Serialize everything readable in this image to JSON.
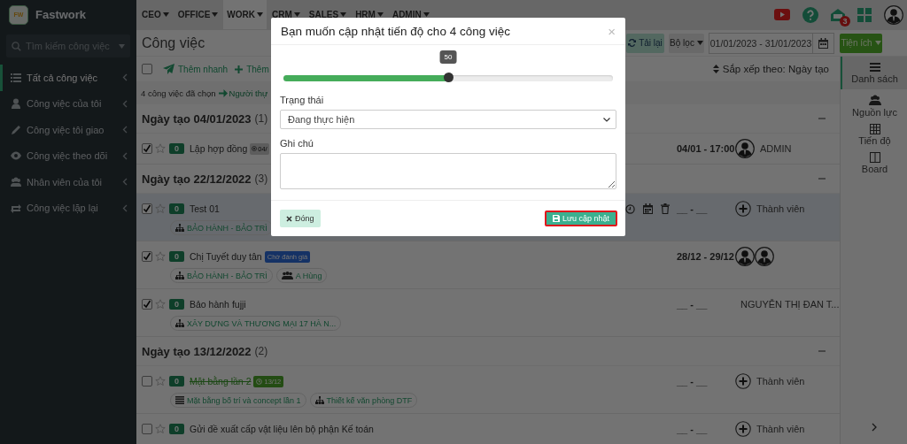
{
  "topbar": {
    "brand": "Fastwork",
    "logo_text": "FW",
    "nav": [
      {
        "label": "CEO",
        "selected": false
      },
      {
        "label": "OFFICE",
        "selected": false
      },
      {
        "label": "WORK",
        "selected": true
      },
      {
        "label": "CRM",
        "selected": false
      },
      {
        "label": "SALES",
        "selected": false
      },
      {
        "label": "HRM",
        "selected": false
      },
      {
        "label": "ADMIN",
        "selected": false
      }
    ],
    "notification_count": "3"
  },
  "sidebar": {
    "search_placeholder": "Tìm kiếm công việc",
    "items": [
      {
        "label": "Tất cả công việc",
        "selected": true
      },
      {
        "label": "Công việc của tôi",
        "selected": false
      },
      {
        "label": "Công việc tôi giao",
        "selected": false
      },
      {
        "label": "Công việc theo dõi",
        "selected": false
      },
      {
        "label": "Nhân viên của tôi",
        "selected": false
      },
      {
        "label": "Công việc lặp lại",
        "selected": false
      }
    ]
  },
  "header": {
    "title": "Công việc",
    "reload": "Tải lại",
    "filter": "Bộ lọc",
    "date_range": "01/01/2023 - 31/01/2023",
    "utilities": "Tiện ích"
  },
  "toolbar": {
    "select_all_checked": false,
    "quick_add": "Thêm nhanh",
    "add": "Thêm",
    "sort": "Sắp xếp theo: Ngày tạo"
  },
  "selection": {
    "count_text": "4 công việc đã chọn",
    "assign": "Người thự"
  },
  "groups": [
    {
      "title": "Ngày tạo 04/01/2023",
      "count": "(1)",
      "tasks": [
        {
          "checked": true,
          "highlighted": false,
          "done": false,
          "count": "0",
          "title": "Lập hợp đồng",
          "badges": [
            {
              "kind": "viewed",
              "text": "04/"
            }
          ],
          "date": "04/01 - 17:00",
          "assignee": {
            "kind": "avatar",
            "name": "ADMIN"
          }
        }
      ]
    },
    {
      "title": "Ngày tạo 22/12/2022",
      "count": "(3)",
      "tasks": [
        {
          "checked": true,
          "highlighted": true,
          "done": false,
          "count": "0",
          "title": "Test 01",
          "tags": [
            {
              "kind": "org",
              "text": "BẢO HÀNH - BẢO TRÌ"
            }
          ],
          "date": "__ - __",
          "assignee": {
            "kind": "add",
            "name": "Thành viên"
          }
        },
        {
          "checked": true,
          "highlighted": false,
          "done": false,
          "count": "0",
          "title": "Chị Tuyết duy tân",
          "badges": [
            {
              "kind": "status",
              "text": "Chờ đánh giá"
            }
          ],
          "tags": [
            {
              "kind": "org",
              "text": "BẢO HÀNH - BẢO TRÌ"
            },
            {
              "kind": "people",
              "text": "A Hùng"
            }
          ],
          "date": "28/12 - 29/12",
          "assignee": {
            "kind": "pair"
          }
        },
        {
          "checked": true,
          "highlighted": false,
          "done": false,
          "count": "0",
          "title": "Bảo hành fujji",
          "tags": [
            {
              "kind": "org",
              "text": "XÂY DỰNG VÀ THƯƠNG MẠI 17 HÀ N..."
            }
          ],
          "date": "__ - __",
          "assignee": {
            "kind": "photo",
            "name": "NGUYỄN THỊ ĐAN T..."
          }
        }
      ]
    },
    {
      "title": "Ngày tạo 13/12/2022",
      "count": "(2)",
      "tasks": [
        {
          "checked": false,
          "highlighted": false,
          "done": true,
          "count": "0",
          "title": "Mặt bằng lần 2",
          "badges": [
            {
              "kind": "due",
              "text": "13/12"
            }
          ],
          "tags": [
            {
              "kind": "list",
              "text": "Mặt bằng bố trí và concept lần 1"
            },
            {
              "kind": "org",
              "text": "Thiết kế văn phòng DTF"
            }
          ],
          "date": "__ - __",
          "assignee": {
            "kind": "add",
            "name": "Thành viên"
          }
        },
        {
          "checked": false,
          "highlighted": false,
          "done": false,
          "count": "0",
          "title": "Gửi đề xuất cấp vật liệu lên bộ phận Kế toán",
          "date": "__ - __",
          "assignee": {
            "kind": "add",
            "name": "Thành viên"
          }
        }
      ]
    }
  ],
  "views": [
    {
      "label": "Danh sách",
      "selected": true
    },
    {
      "label": "Nguồn lực",
      "selected": false
    },
    {
      "label": "Tiến độ",
      "selected": false
    },
    {
      "label": "Board",
      "selected": false
    }
  ],
  "modal": {
    "title": "Bạn muốn cập nhật tiến độ cho 4 công việc",
    "close": "×",
    "progress": {
      "level": 0.5,
      "reading": "50"
    },
    "status_label": "Trạng thái",
    "status_value": "Đang thực hiện",
    "note_label": "Ghi chú",
    "close_button": "Đóng",
    "save_button": {
      "label": "Lưu cập nhật",
      "focused": true
    }
  }
}
